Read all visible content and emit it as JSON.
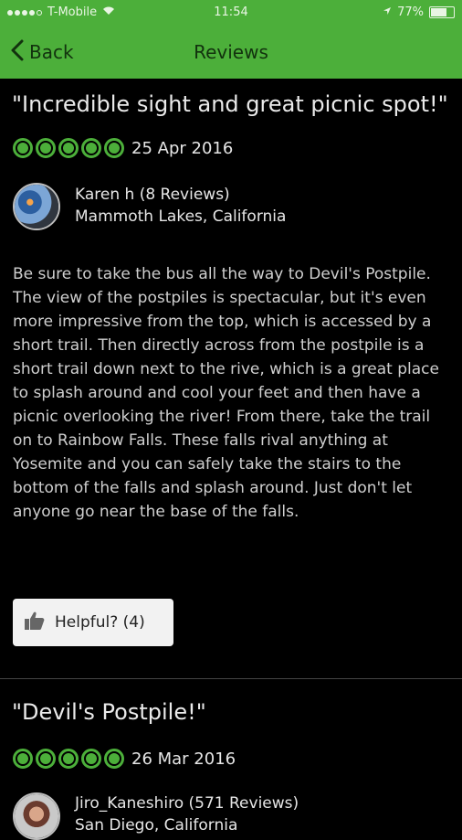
{
  "status_bar": {
    "carrier": "T-Mobile",
    "time": "11:54",
    "battery": "77%",
    "battery_level": 0.77
  },
  "nav": {
    "back_label": "Back",
    "title": "Reviews"
  },
  "reviews": [
    {
      "title": "\"Incredible sight and great picnic spot!\"",
      "rating": 5,
      "date": "25 Apr 2016",
      "user": "Karen h (8 Reviews)",
      "location": "Mammoth Lakes, California",
      "body": "Be sure to take the bus all the way to Devil's Postpile. The view of the postpiles is spectacular, but it's even more impressive from the top, which is accessed by a short trail. Then directly across from the postpile is a short trail down next to the rive, which is a great place to splash around and cool your feet and then have a picnic overlooking the river! From there, take the trail on to Rainbow Falls. These falls rival anything at Yosemite and you can safely take the stairs to the bottom of the falls and splash around. Just don't let anyone go near the base of the falls.",
      "helpful_label": "Helpful? (4)"
    },
    {
      "title": "\"Devil's Postpile!\"",
      "rating": 5,
      "date": "26 Mar 2016",
      "user": "Jiro_Kaneshiro (571 Reviews)",
      "location": "San Diego, California"
    }
  ],
  "colors": {
    "brand_green": "#4caf3a",
    "background": "#000000"
  }
}
